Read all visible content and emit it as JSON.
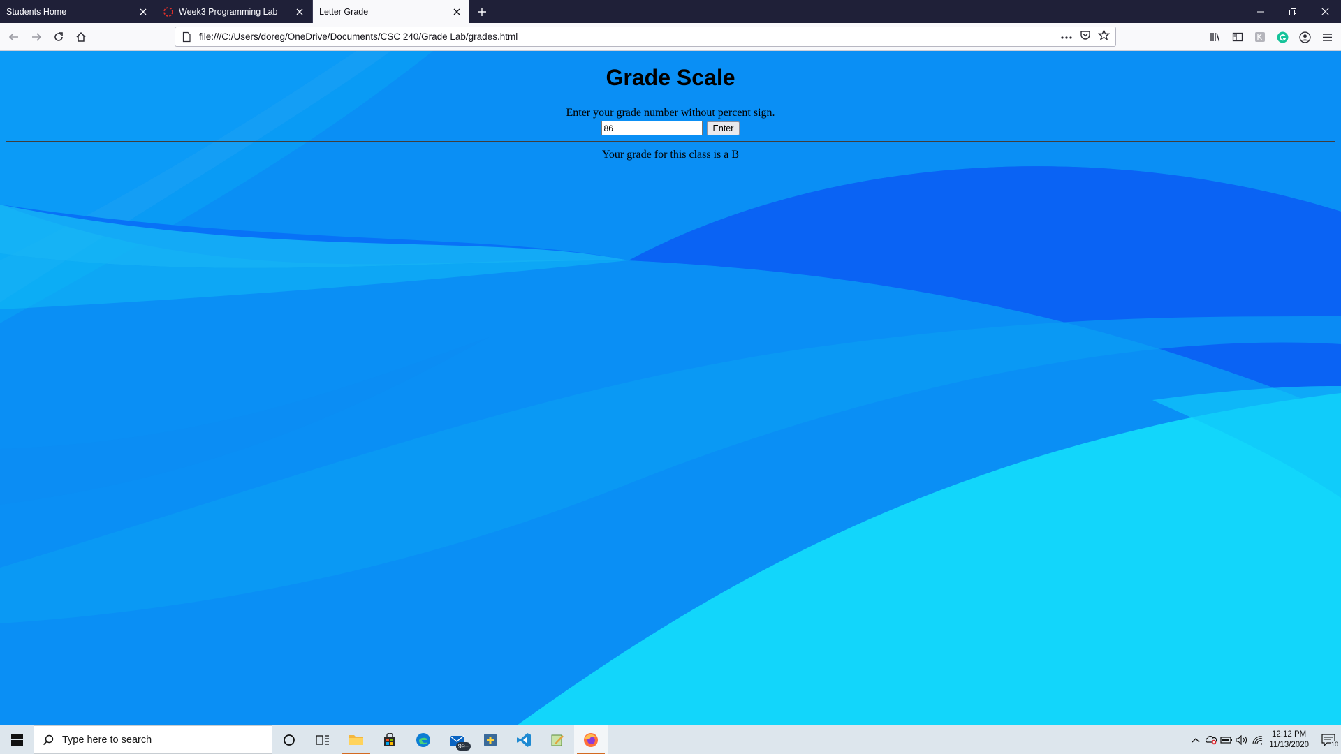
{
  "browser": {
    "tabs": [
      {
        "title": "Students Home",
        "active": false
      },
      {
        "title": "Week3 Programming Lab",
        "active": false
      },
      {
        "title": "Letter Grade",
        "active": true
      }
    ],
    "url": "file:///C:/Users/doreg/OneDrive/Documents/CSC 240/Grade Lab/grades.html"
  },
  "page": {
    "heading": "Grade Scale",
    "prompt": "Enter your grade number without percent sign.",
    "grade_value": "86",
    "enter_label": "Enter",
    "result": "Your grade for this class is a B"
  },
  "taskbar": {
    "search_placeholder": "Type here to search",
    "mail_badge": "99+",
    "time": "12:12 PM",
    "date": "11/13/2020",
    "notification_count": "10"
  },
  "colors": {
    "tabstrip": "#1f2038",
    "toolbar": "#f9f9fb",
    "page_bg": "#0a8ff5",
    "taskbar": "#dde6ed"
  }
}
